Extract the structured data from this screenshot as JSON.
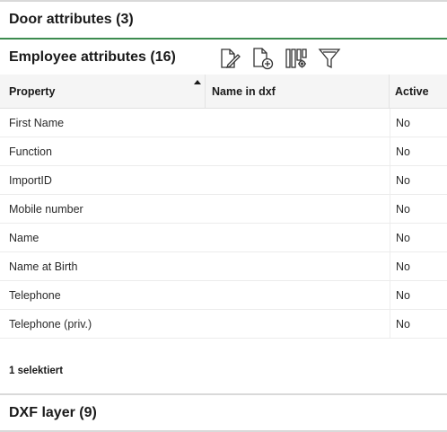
{
  "sections": {
    "door": {
      "title": "Door attributes (3)"
    },
    "employee": {
      "title": "Employee attributes (16)"
    },
    "dxf": {
      "title": "DXF layer (9)"
    }
  },
  "toolbar": {
    "icons": [
      "edit-document-icon",
      "add-document-icon",
      "column-settings-icon",
      "filter-icon"
    ]
  },
  "table": {
    "columns": [
      "Property",
      "Name in dxf",
      "Active"
    ],
    "sorted_column": "Property",
    "sort_direction": "ascending",
    "rows": [
      {
        "property": "First Name",
        "name_in_dxf": "",
        "active": "No"
      },
      {
        "property": "Function",
        "name_in_dxf": "",
        "active": "No"
      },
      {
        "property": "ImportID",
        "name_in_dxf": "",
        "active": "No"
      },
      {
        "property": "Mobile number",
        "name_in_dxf": "",
        "active": "No"
      },
      {
        "property": "Name",
        "name_in_dxf": "",
        "active": "No"
      },
      {
        "property": "Name at Birth",
        "name_in_dxf": "",
        "active": "No"
      },
      {
        "property": "Telephone",
        "name_in_dxf": "",
        "active": "No"
      },
      {
        "property": "Telephone (priv.)",
        "name_in_dxf": "",
        "active": "No"
      }
    ]
  },
  "status": {
    "text": "1 selektiert"
  },
  "colors": {
    "accent": "#3d8b4f",
    "divider": "#d9d9d9",
    "header_bg": "#f5f5f5"
  }
}
